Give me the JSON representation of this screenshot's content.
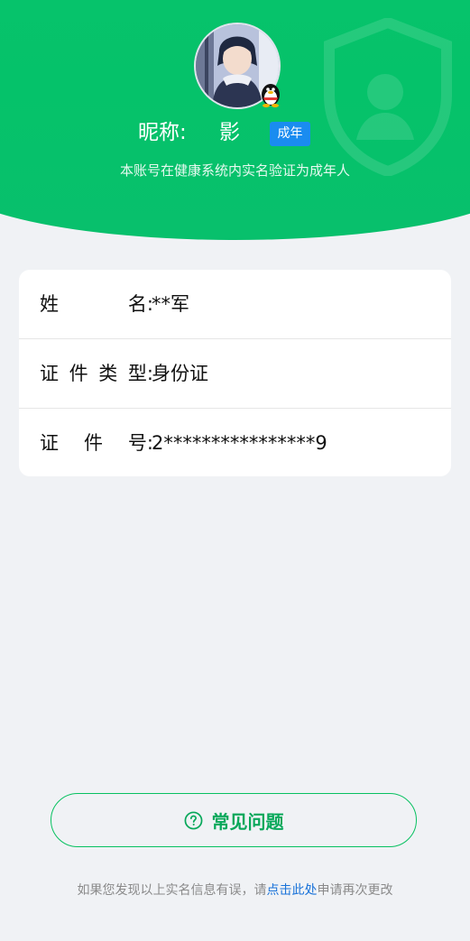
{
  "header": {
    "nickname_label": "昵称:",
    "nickname_value": "影",
    "age_badge": "成年",
    "verify_text": "本账号在健康系统内实名验证为成年人",
    "avatar": "user-avatar",
    "platform_badge": "qq-penguin-icon"
  },
  "info": {
    "rows": [
      {
        "label_chars": [
          "姓",
          "名:"
        ],
        "value": "**军"
      },
      {
        "label_chars": [
          "证",
          "件",
          "类",
          "型:"
        ],
        "value": "身份证"
      },
      {
        "label_chars": [
          "证",
          "件",
          "号:"
        ],
        "value": "2****************9"
      }
    ]
  },
  "faq": {
    "label": "常见问题",
    "icon": "question-circle-icon"
  },
  "footer": {
    "prefix": "如果您发现以上实名信息有误，请",
    "link": "点击此处",
    "suffix": "申请再次更改"
  },
  "colors": {
    "brand_green": "#07c160",
    "badge_blue": "#1a8cf0",
    "link_blue": "#1a73d9",
    "background": "#f0f2f5"
  }
}
